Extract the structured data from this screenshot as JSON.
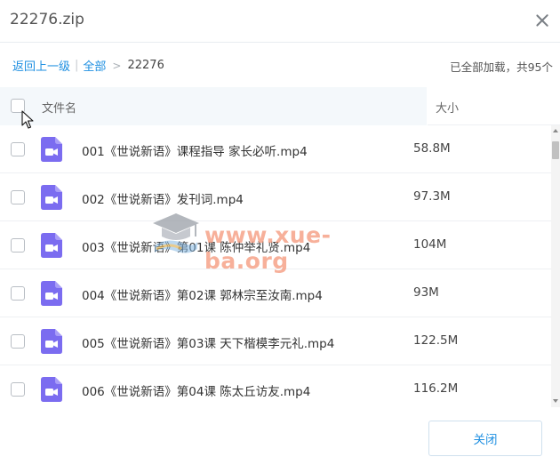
{
  "window": {
    "title": "22276.zip"
  },
  "breadcrumb": {
    "back_label": "返回上一级",
    "separator": "|",
    "all_label": "全部",
    "arrow": ">",
    "current": "22276"
  },
  "status": {
    "load_text": "已全部加载，共95个"
  },
  "table": {
    "col_name": "文件名",
    "col_size": "大小",
    "rows": [
      {
        "name": "001《世说新语》课程指导 家长必听.mp4",
        "size": "58.8M"
      },
      {
        "name": "002《世说新语》发刊词.mp4",
        "size": "97.3M"
      },
      {
        "name": "003《世说新语》第01课 陈仲举礼贤.mp4",
        "size": "104M"
      },
      {
        "name": "004《世说新语》第02课 郭林宗至汝南.mp4",
        "size": "93M"
      },
      {
        "name": "005《世说新语》第03课 天下楷模李元礼.mp4",
        "size": "122.5M"
      },
      {
        "name": "006《世说新语》第04课 陈太丘访友.mp4",
        "size": "116.2M"
      }
    ]
  },
  "watermark": {
    "text": "www.xue-ba.org"
  },
  "footer": {
    "close_label": "关闭"
  },
  "icons": {
    "file": "video-file-icon",
    "close": "close-icon",
    "cursor": "mouse-cursor-icon",
    "logo": "graduation-cap-icon"
  },
  "colors": {
    "accent": "#1e8fe1",
    "video_icon": "#7b6cf0",
    "header_bg": "#f4f8fb"
  }
}
